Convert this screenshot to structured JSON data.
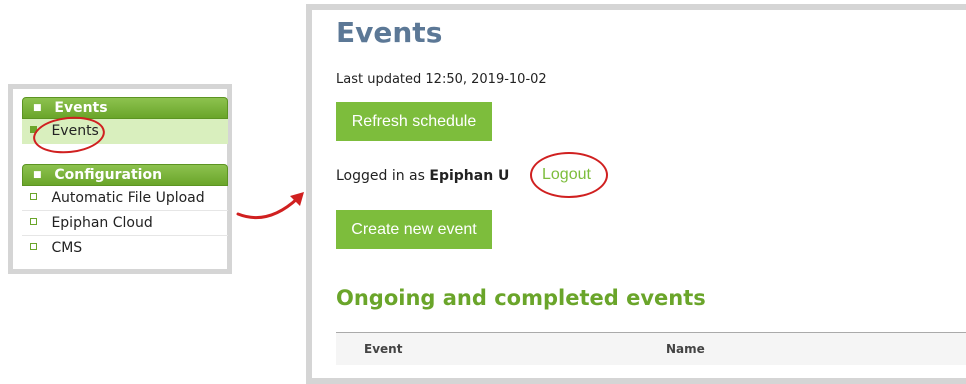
{
  "sidebar": {
    "groups": [
      {
        "header": "Events",
        "items": [
          {
            "label": "Events",
            "active": true
          }
        ]
      },
      {
        "header": "Configuration",
        "items": [
          {
            "label": "Automatic File Upload"
          },
          {
            "label": "Epiphan Cloud"
          },
          {
            "label": "CMS"
          }
        ]
      }
    ]
  },
  "main": {
    "title": "Events",
    "last_updated": "Last updated 12:50, 2019-10-02",
    "refresh_button": "Refresh schedule",
    "logged_in_prefix": "Logged in as",
    "logged_in_user": "Epiphan U",
    "logout_link": "Logout",
    "create_button": "Create new event",
    "section_title": "Ongoing and completed events",
    "table": {
      "columns": [
        "Event",
        "Name"
      ]
    }
  },
  "colors": {
    "accent_green": "#7dbd3c",
    "title_blue": "#5c7896",
    "annotation_red": "#d02020",
    "active_item_bg": "#d9efbe"
  },
  "icons": {
    "header_bullet": "square-bullet-icon",
    "item_bullet": "square-outline-icon",
    "annotation_arrow": "curved-arrow-icon"
  }
}
